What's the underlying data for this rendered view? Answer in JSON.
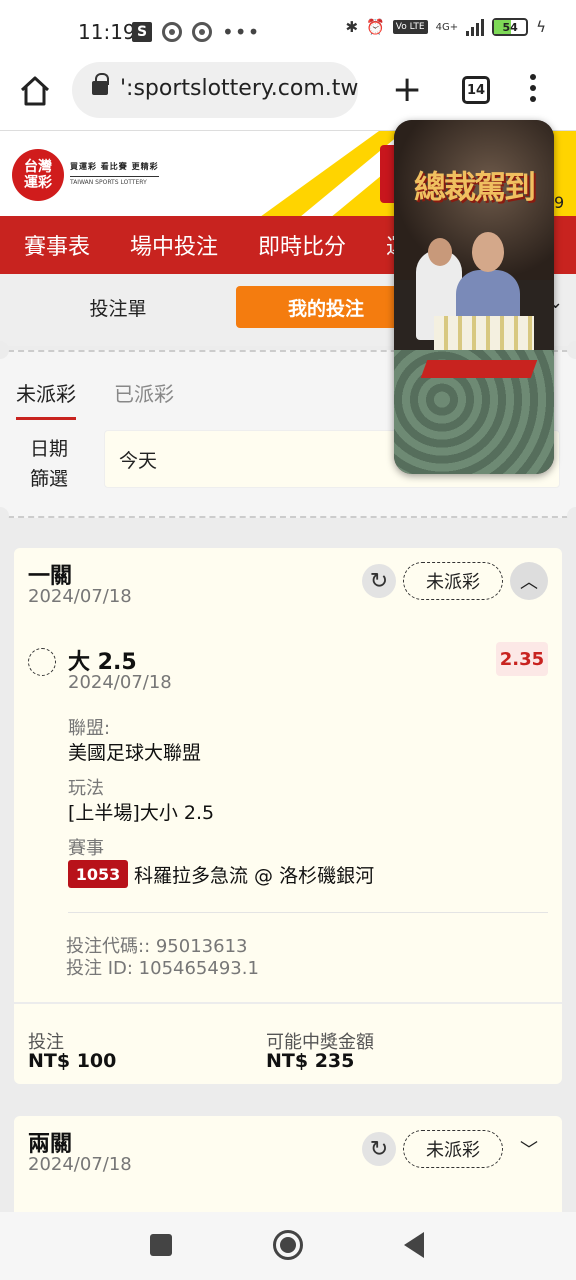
{
  "status_bar": {
    "time": "11:19",
    "s_icon": "S",
    "dots": "•••",
    "network": "4G+",
    "lte": "Vo LTE",
    "battery": "54",
    "battery_fill_fraction": 0.54,
    "icons": [
      "bluetooth-icon",
      "alarm-icon",
      "charging-icon"
    ]
  },
  "browser": {
    "url": "':sportslottery.com.tw",
    "tab_count": "14",
    "icons": [
      "home-icon",
      "lock-icon",
      "plus-icon",
      "tabs-icon",
      "menu-icon"
    ]
  },
  "site": {
    "logo_line1": "台灣",
    "logo_line2": "運彩",
    "tagline": "買運彩 看比賽 更精彩",
    "logo_en": "TAIWAN SPORTS LOTTERY",
    "corner_digit": "9",
    "nav": [
      "賽事表",
      "場中投注",
      "即時比分",
      "運彩"
    ]
  },
  "bet_tabs": {
    "betslip": "投注單",
    "mybets": "我的投注",
    "chevron": "⌄"
  },
  "filter": {
    "tab_unsettled": "未派彩",
    "tab_settled": "已派彩",
    "date_label_1": "日期",
    "date_label_2": "篩選",
    "date_value": "今天"
  },
  "card1": {
    "title": "一關",
    "date": "2024/07/18",
    "status": "未派彩",
    "selection": "大 2.5",
    "selection_date": "2024/07/18",
    "odds": "2.35",
    "league_label": "聯盟:",
    "league": "美國足球大聯盟",
    "market_label": "玩法",
    "market": "[上半場]大小 2.5",
    "event_label": "賽事",
    "match_no": "1053",
    "match": "科羅拉多急流 @ 洛杉磯銀河",
    "bet_code": "投注代碼:: 95013613",
    "bet_id": "投注 ID: 105465493.1",
    "stake_label": "投注",
    "stake": "NT$ 100",
    "payout_label": "可能中獎金額",
    "payout": "NT$ 235"
  },
  "card2": {
    "title": "兩關",
    "date": "2024/07/18",
    "status": "未派彩"
  },
  "overlay": {
    "title": "總裁駕到"
  },
  "colors": {
    "brand_red": "#c8231f",
    "accent_orange": "#f47c0f",
    "banner_yellow": "#ffd400",
    "card_bg": "#fffdf0"
  }
}
